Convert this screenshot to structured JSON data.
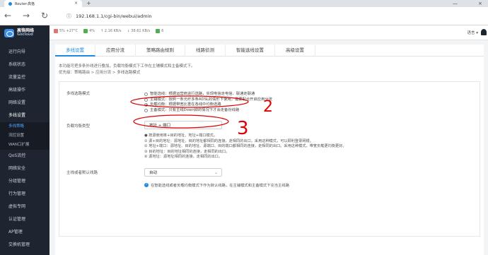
{
  "browser": {
    "tab_title": "Router-高恪",
    "url": "192.168.1.1/cgi-bin/webui/admin"
  },
  "header": {
    "logo_cn": "高恪网络",
    "logo_en": "Gocloud",
    "stats": [
      {
        "icon": "cpu-icon",
        "text": "5% +27°C",
        "color": "#e57373"
      },
      {
        "icon": "memory-icon",
        "text": "4%",
        "color": "#4caf50"
      },
      {
        "icon": "upload-icon",
        "text": "↑ 2.16 KB/s",
        "color": "#1e88e5"
      },
      {
        "icon": "download-icon",
        "text": "↓ 38.61 KB/s",
        "color": "#1e88e5"
      },
      {
        "icon": "device-icon",
        "text": "6",
        "color": "#4caf50"
      }
    ],
    "language": "语言 ▾"
  },
  "sidebar": {
    "items": [
      {
        "label": "运行向导"
      },
      {
        "label": "系统状态"
      },
      {
        "label": "流量监控"
      },
      {
        "label": "高级操作"
      },
      {
        "label": "网络设置"
      },
      {
        "label": "多线设置"
      }
    ],
    "subitems": [
      {
        "label": "多线策略",
        "active": true
      },
      {
        "label": "流控设置",
        "active": false
      },
      {
        "label": "WAN口扩展",
        "active": false
      }
    ],
    "items_after": [
      {
        "label": "QoS流控"
      },
      {
        "label": "网络安全"
      },
      {
        "label": "分组管理"
      },
      {
        "label": "行为管理"
      },
      {
        "label": "虚拟专网"
      },
      {
        "label": "认证管理"
      },
      {
        "label": "AP管理"
      },
      {
        "label": "交换机管理"
      }
    ]
  },
  "tabs": [
    {
      "label": "多线设置",
      "active": true
    },
    {
      "label": "应用分流",
      "active": false
    },
    {
      "label": "策略路由规则",
      "active": false
    },
    {
      "label": "线路侦测",
      "active": false
    },
    {
      "label": "智能选线设置",
      "active": false
    },
    {
      "label": "高级设置",
      "active": false
    }
  ],
  "description": {
    "line1": "本功能可把多条外线进行叠加，负载均衡模式下工作在主辅模式和主备模式下。",
    "line2": "优先级：策略路由 > 应用分流 > 多线选路模式"
  },
  "form": {
    "mode_label": "多线选路模式",
    "mode_options": [
      {
        "text": "智能选线：根据运营商进行选路，实现电信走电信、联通走联通",
        "selected": false
      },
      {
        "text": "主辅模式：按照一条光纤多条ADSL的情形下使用，需要配合开启应用分流",
        "selected": false
      },
      {
        "text": "负载均衡：根据带宽比重在各线中均衡选路",
        "selected": true
      },
      {
        "text": "主备模式：只有主线Down掉的情况下才会走备份线路",
        "selected": false
      }
    ],
    "lb_type_label": "负载均衡类型",
    "lb_type_value": "地址 + 端口",
    "lb_help": [
      "● 按源使用率+目的地址、地址+端口模式。",
      "① 源+目的地址：源地址、目的地址都相同的连接，走相同的出口。采用这种模式，可以顾利登录网银。",
      "② 地址+端口：源地址、目的地址、源端口、目的端口都相同的连接，走相同的出口。采用这种模式，带宽负载更均衡更好。",
      "③ 目的地址：目的地址相同的连接，走相同的出口。",
      "④ 源地址：源地址相同的连接，走相同的出口。"
    ],
    "default_line_label": "主线或者默认线路",
    "default_line_value": "自动",
    "default_line_note": "在智能选线或者负载均衡模式下作为默认线路，在主辅模式和主备模式下充当主线路"
  },
  "annotations": {
    "mark2": "2",
    "mark3": "3",
    "color": "#e00000"
  }
}
